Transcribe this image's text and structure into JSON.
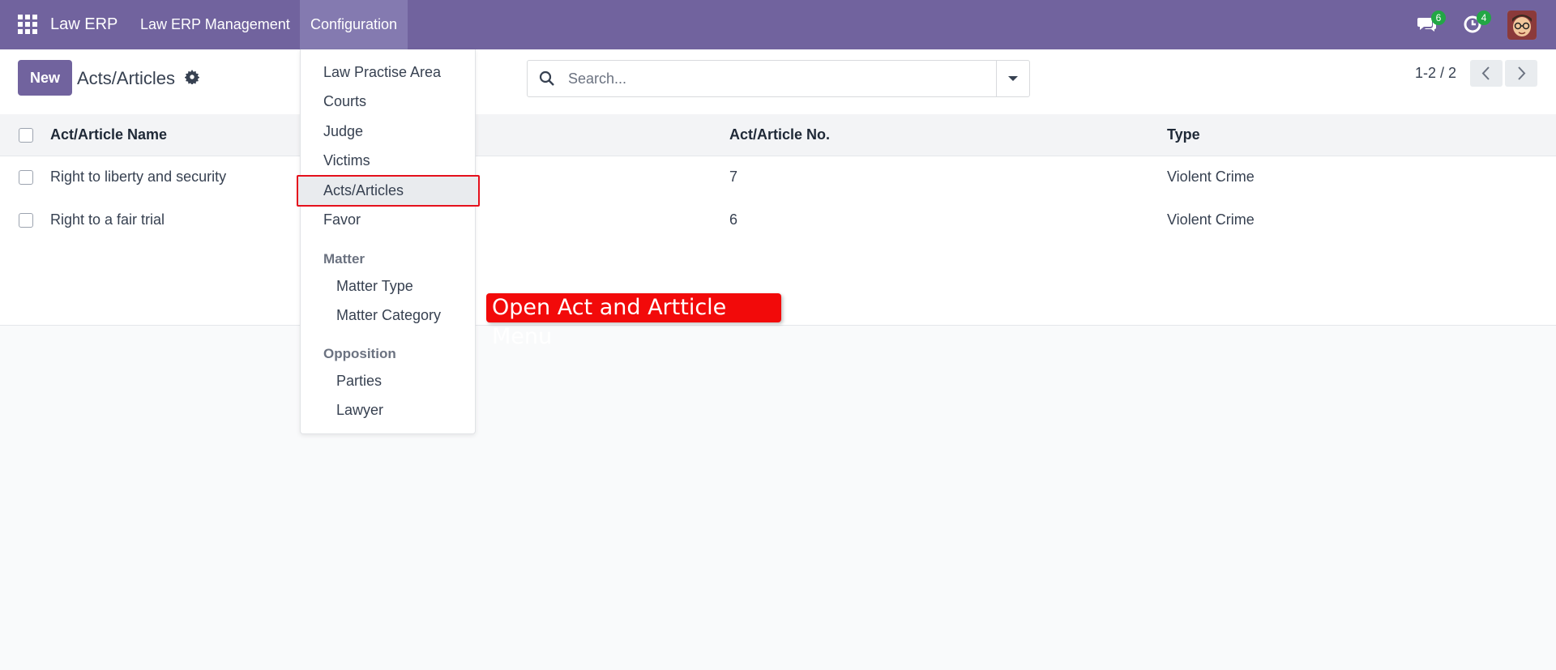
{
  "navbar": {
    "brand": "Law ERP",
    "menu_management": "Law ERP Management",
    "menu_configuration": "Configuration",
    "messages_count": "6",
    "activities_count": "4"
  },
  "control": {
    "new_label": "New",
    "title": "Acts/Articles",
    "search_placeholder": "Search...",
    "pager_value": "1-2 / 2"
  },
  "table": {
    "columns": [
      "Act/Article Name",
      "Act/Article No.",
      "Type"
    ],
    "rows": [
      {
        "name": "Right to liberty and security",
        "number": "7",
        "type": "Violent Crime"
      },
      {
        "name": "Right to a fair trial",
        "number": "6",
        "type": "Violent Crime"
      }
    ]
  },
  "menu": {
    "items": [
      "Law Practise Area",
      "Courts",
      "Judge",
      "Victims",
      "Acts/Articles",
      "Favor"
    ],
    "section_matter": "Matter",
    "matter_items": [
      "Matter Type",
      "Matter Category"
    ],
    "section_opposition": "Opposition",
    "opposition_items": [
      "Parties",
      "Lawyer"
    ],
    "active_item": "Acts/Articles"
  },
  "annotation": "Open Act and Artticle Menu",
  "colors": {
    "navbar": "#71639e",
    "primary": "#71639e",
    "badge": "#22a745",
    "highlight_border": "#e5101c",
    "callout": "#f20a0a"
  }
}
